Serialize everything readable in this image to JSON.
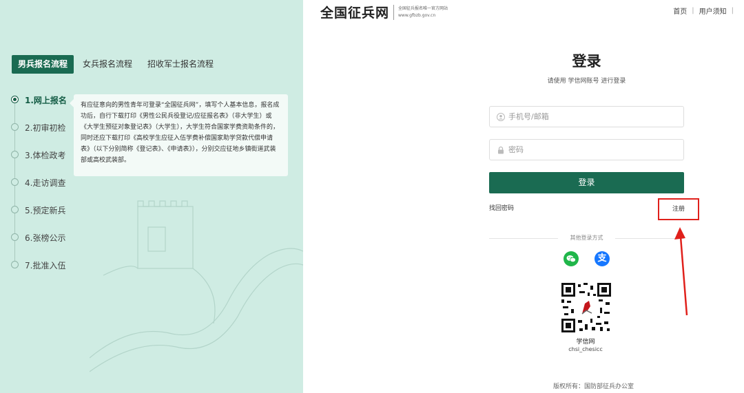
{
  "left_panel": {
    "tabs": [
      {
        "label": "男兵报名流程",
        "active": true
      },
      {
        "label": "女兵报名流程",
        "active": false
      },
      {
        "label": "招收军士报名流程",
        "active": false
      }
    ],
    "steps": [
      {
        "label": "1.网上报名",
        "active": true
      },
      {
        "label": "2.初审初检",
        "active": false
      },
      {
        "label": "3.体检政考",
        "active": false
      },
      {
        "label": "4.走访调查",
        "active": false
      },
      {
        "label": "5.预定新兵",
        "active": false
      },
      {
        "label": "6.张榜公示",
        "active": false
      },
      {
        "label": "7.批准入伍",
        "active": false
      }
    ],
    "description": "有应征意向的男性青年可登录“全国征兵网”，填写个人基本信息，报名成功后，自行下载打印《男性公民兵役登记/应征报名表》（非大学生）或《大学生预征对象登记表》（大学生），大学生符合国家学费资助条件的，同时还应下载打印《高校学生应征入伍学费补偿国家助学贷款代偿申请表》（以下分别简称《登记表》、《申请表》），分别交应征地乡镇街道武装部或高校武装部。"
  },
  "header": {
    "logo_title": "全国征兵网",
    "logo_subtitle": "全国征兵报名唯一官方网站",
    "logo_url": "www.gfbzb.gov.cn",
    "nav": [
      "首页",
      "用户须知"
    ]
  },
  "login": {
    "title": "登录",
    "subtitle": "请使用 学信网账号 进行登录",
    "account_placeholder": "手机号/邮箱",
    "password_placeholder": "密码",
    "login_button": "登录",
    "forgot_link": "找回密码",
    "register_link": "注册",
    "other_methods": "其他登录方式",
    "social": [
      {
        "name": "wechat-icon",
        "color": "#20b64a"
      },
      {
        "name": "alipay-icon",
        "label": "支",
        "color": "#1677ff"
      }
    ],
    "qr_name": "学信网",
    "qr_id": "chsi_chesicc"
  },
  "footer": {
    "copyright": "版权所有：国防部征兵办公室"
  },
  "colors": {
    "brand_green": "#1a6b52",
    "left_bg": "#cfece3",
    "highlight_red": "#e0201b"
  }
}
